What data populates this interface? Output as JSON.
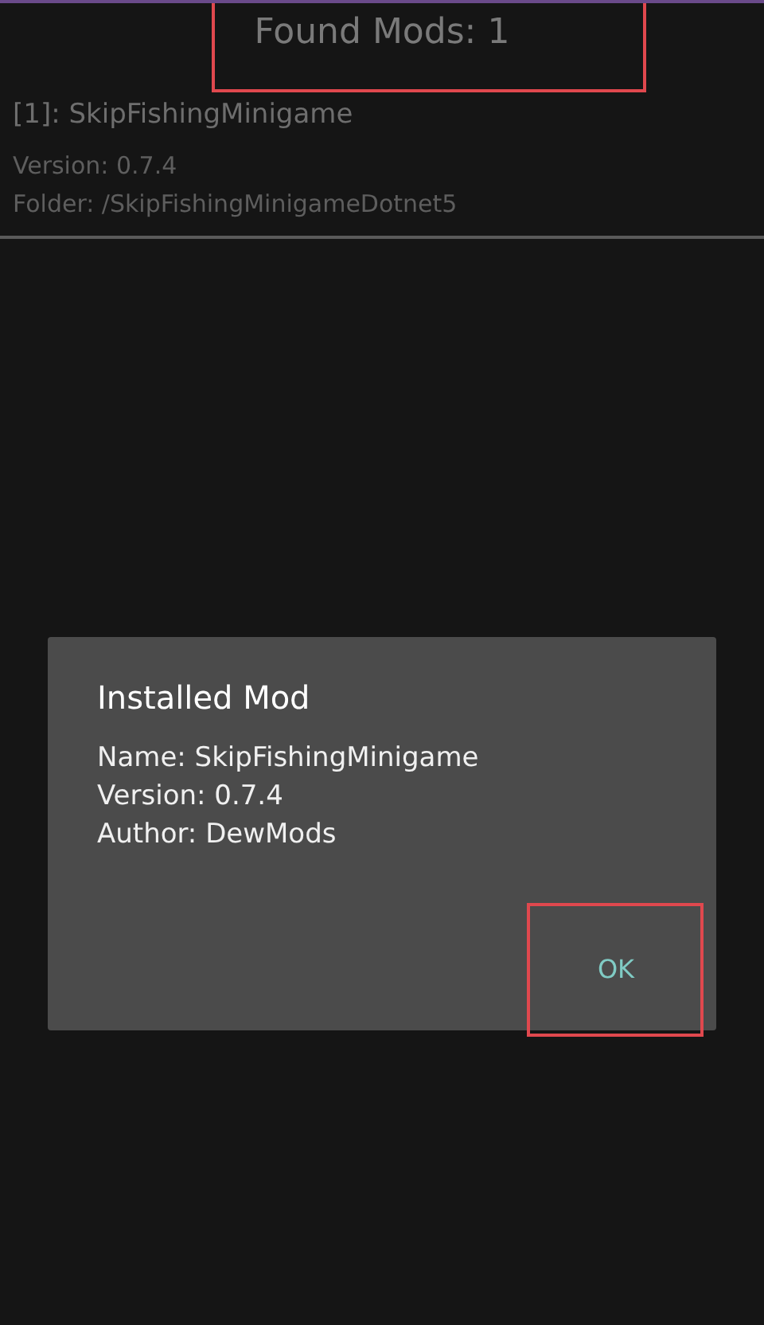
{
  "header": {
    "title": "Found Mods: 1"
  },
  "mods": [
    {
      "name": "[1]: SkipFishingMinigame",
      "version": "Version: 0.7.4",
      "folder": "Folder: /SkipFishingMinigameDotnet5"
    }
  ],
  "dialog": {
    "title": "Installed Mod",
    "lines": [
      "Name: SkipFishingMinigame",
      "Version: 0.7.4",
      "Author: DewMods"
    ],
    "button": "OK"
  }
}
